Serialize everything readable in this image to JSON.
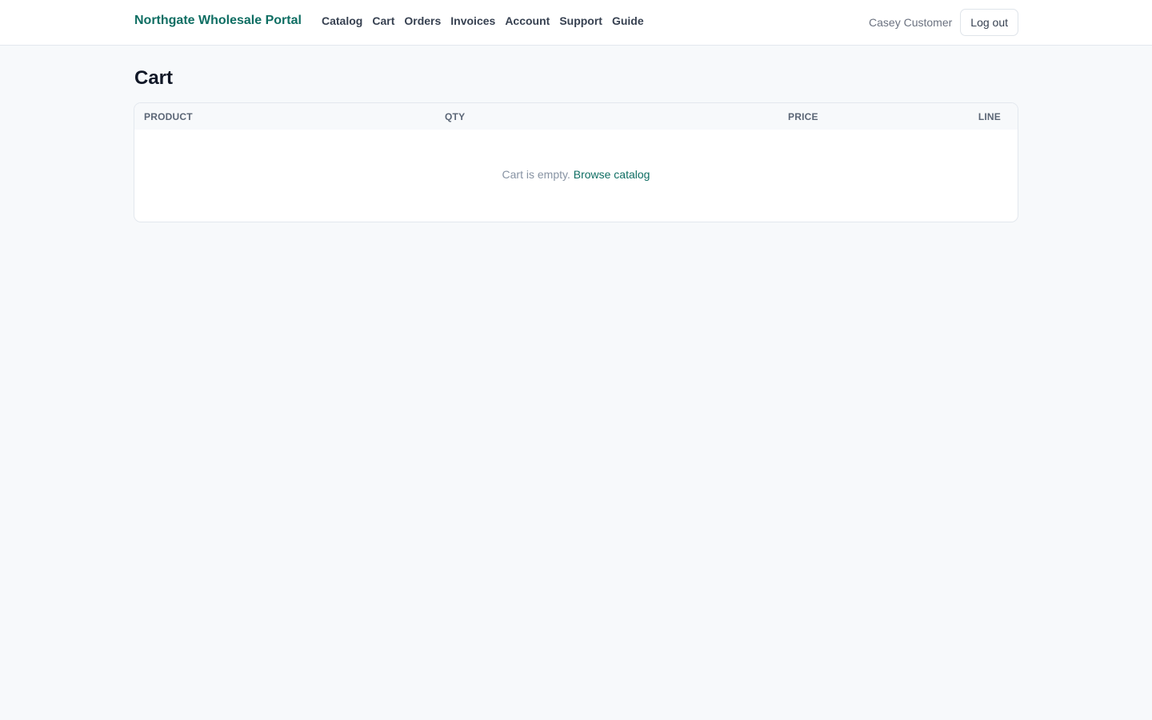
{
  "header": {
    "brand": "Northgate Wholesale Portal",
    "nav": [
      {
        "label": "Catalog"
      },
      {
        "label": "Cart"
      },
      {
        "label": "Orders"
      },
      {
        "label": "Invoices"
      },
      {
        "label": "Account"
      },
      {
        "label": "Support"
      },
      {
        "label": "Guide"
      }
    ],
    "user_name": "Casey Customer",
    "logout_label": "Log out"
  },
  "main": {
    "title": "Cart",
    "table": {
      "columns": [
        "PRODUCT",
        "QTY",
        "PRICE",
        "LINE"
      ],
      "rows": [],
      "empty_text": "Cart is empty.",
      "empty_link": "Browse catalog"
    }
  },
  "colors": {
    "accent": "#0f6e63",
    "background": "#f7f9fb"
  }
}
